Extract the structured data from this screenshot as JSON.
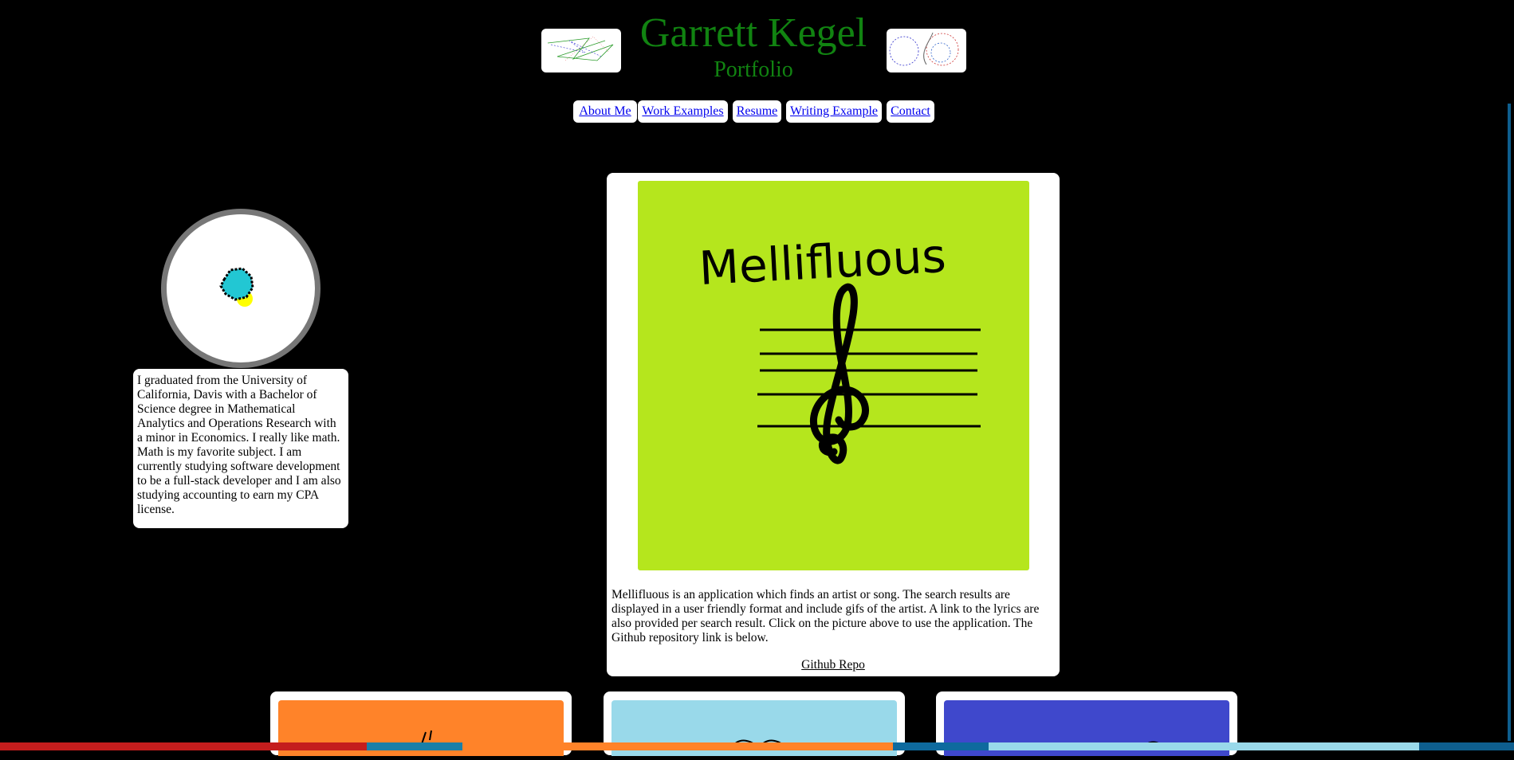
{
  "header": {
    "title": "Garrett Kegel",
    "subtitle": "Portfolio"
  },
  "nav": {
    "items": [
      {
        "label": "About Me"
      },
      {
        "label": "Work Examples"
      },
      {
        "label": "Resume"
      },
      {
        "label": "Writing Example"
      },
      {
        "label": "Contact"
      }
    ]
  },
  "about": {
    "text": "I graduated from the University of California, Davis with a Bachelor of Science degree in Mathematical Analytics and Operations Research with a minor in Economics. I really like math. Math is my favorite subject. I am currently studying software development to be a full-stack developer and I am also studying accounting to earn my CPA license."
  },
  "featured_project": {
    "image_text": "Mellifluous",
    "image_color": "#b5e61d",
    "description": "Mellifluous is an application which finds an artist or song. The search results are displayed in a user friendly format and include gifs of the artist. A link to the lyrics are also provided per search result. Click on the picture above to use the application. The Github repository link is below.",
    "repo_link": "Github Repo"
  },
  "project_thumbnails": [
    {
      "color": "#ff8329"
    },
    {
      "color": "#99d9ea"
    },
    {
      "color": "#3f48cc"
    }
  ],
  "colors": {
    "background": "#000000",
    "title_green": "#118311",
    "link_blue": "#0000ee"
  }
}
